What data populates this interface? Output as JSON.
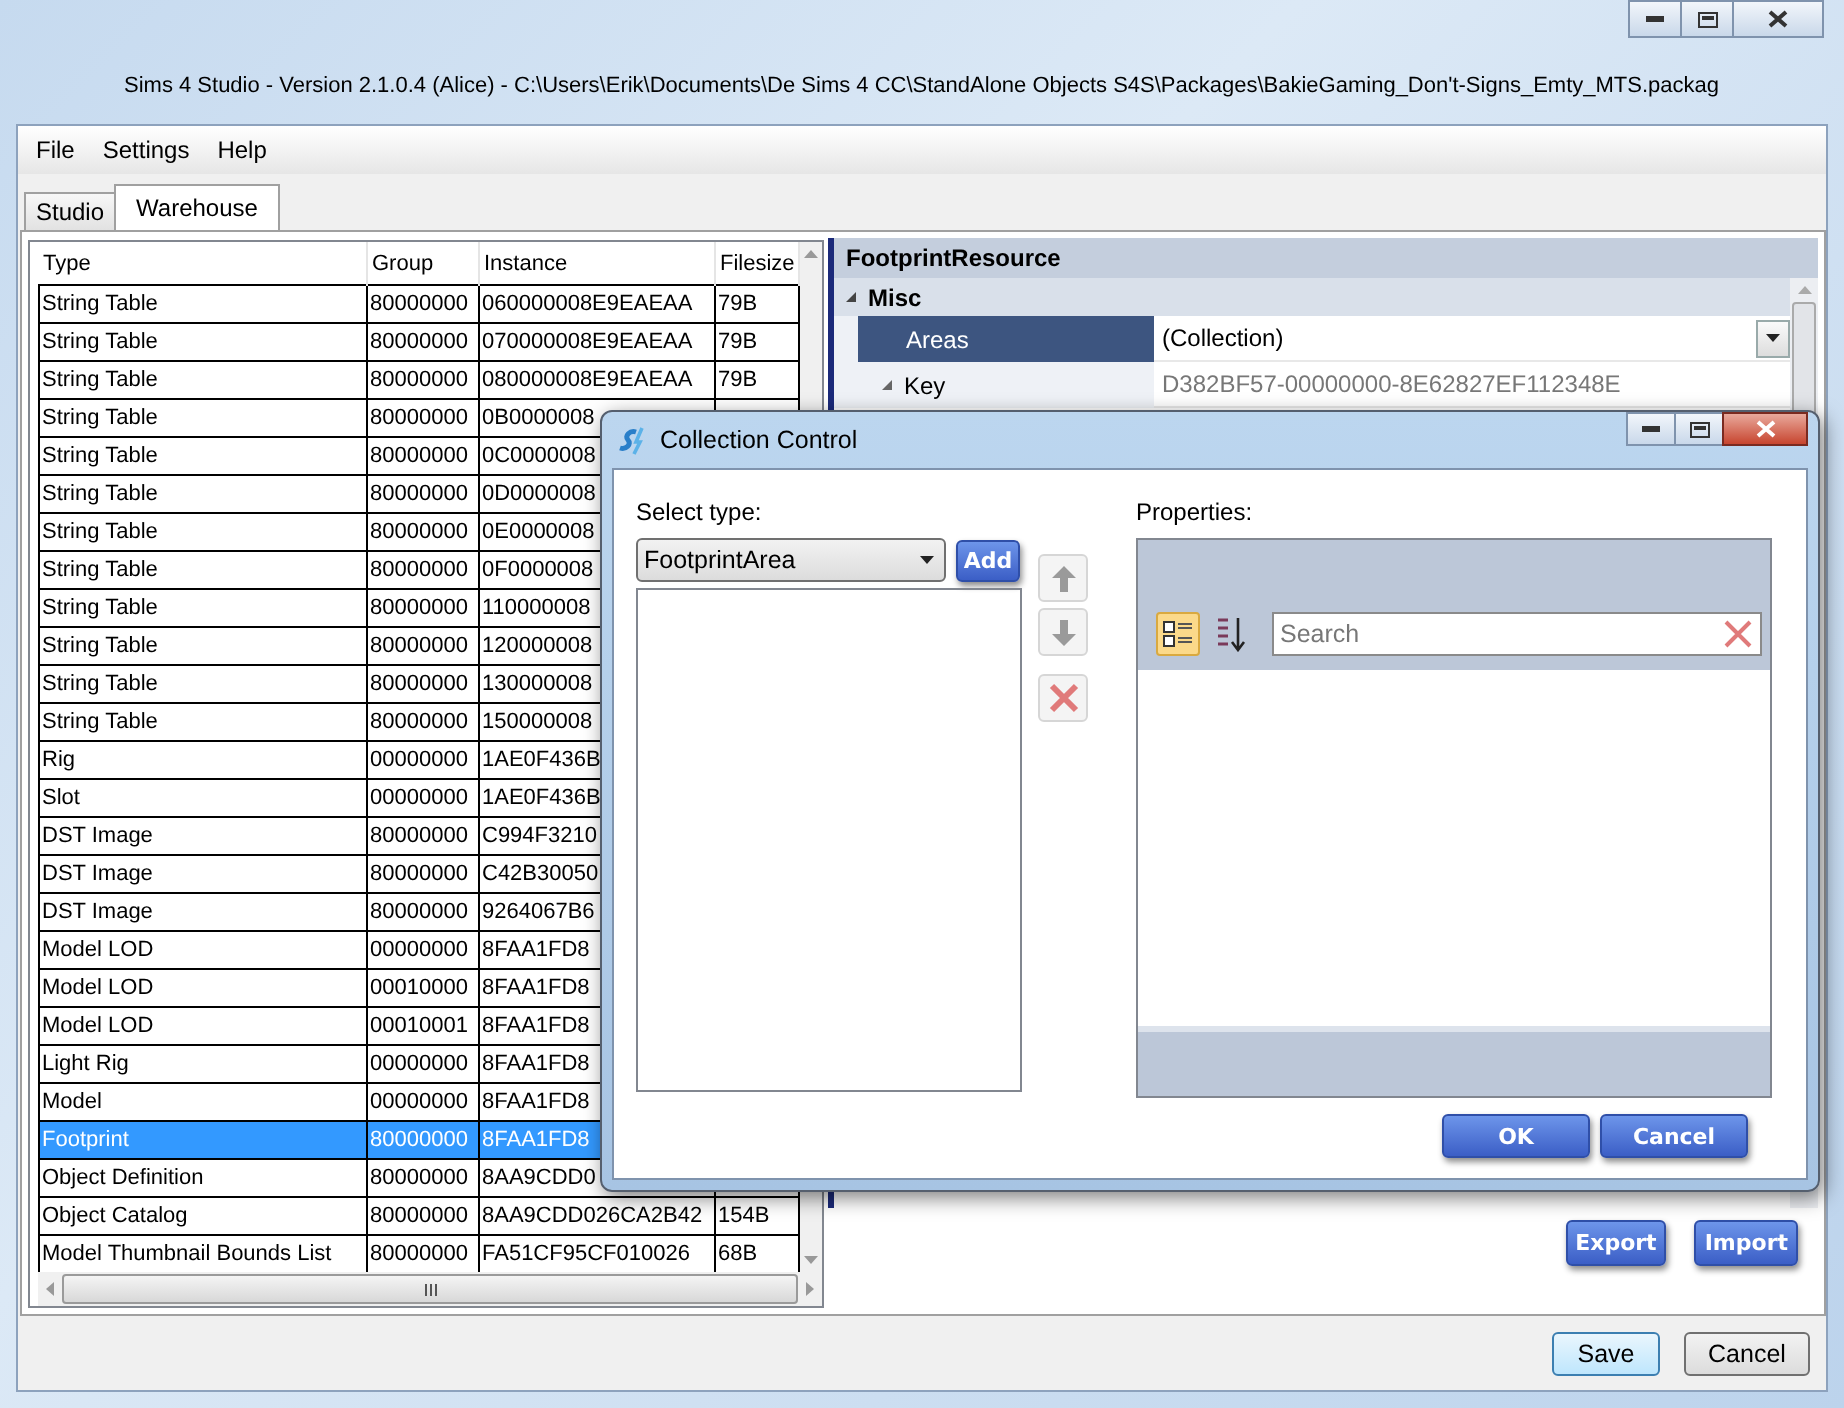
{
  "window": {
    "title": "Sims 4 Studio - Version 2.1.0.4  (Alice)   - C:\\Users\\Erik\\Documents\\De Sims 4 CC\\StandAlone Objects S4S\\Packages\\BakieGaming_Don't-Signs_Emty_MTS.packag"
  },
  "menu": [
    "File",
    "Settings",
    "Help"
  ],
  "tabs": [
    {
      "label": "Studio",
      "selected": false
    },
    {
      "label": "Warehouse",
      "selected": true
    }
  ],
  "table": {
    "columns": [
      "Type",
      "Group",
      "Instance",
      "Filesize"
    ],
    "rows": [
      {
        "cells": [
          "String Table",
          "80000000",
          "060000008E9EAEAA",
          "79B"
        ],
        "selected": false
      },
      {
        "cells": [
          "String Table",
          "80000000",
          "070000008E9EAEAA",
          "79B"
        ],
        "selected": false
      },
      {
        "cells": [
          "String Table",
          "80000000",
          "080000008E9EAEAA",
          "79B"
        ],
        "selected": false
      },
      {
        "cells": [
          "String Table",
          "80000000",
          "0B0000008"
        ],
        "selected": false
      },
      {
        "cells": [
          "String Table",
          "80000000",
          "0C0000008"
        ],
        "selected": false
      },
      {
        "cells": [
          "String Table",
          "80000000",
          "0D0000008"
        ],
        "selected": false
      },
      {
        "cells": [
          "String Table",
          "80000000",
          "0E0000008"
        ],
        "selected": false
      },
      {
        "cells": [
          "String Table",
          "80000000",
          "0F0000008"
        ],
        "selected": false
      },
      {
        "cells": [
          "String Table",
          "80000000",
          "110000008"
        ],
        "selected": false
      },
      {
        "cells": [
          "String Table",
          "80000000",
          "120000008"
        ],
        "selected": false
      },
      {
        "cells": [
          "String Table",
          "80000000",
          "130000008"
        ],
        "selected": false
      },
      {
        "cells": [
          "String Table",
          "80000000",
          "150000008"
        ],
        "selected": false
      },
      {
        "cells": [
          "Rig",
          "00000000",
          "1AE0F436B"
        ],
        "selected": false
      },
      {
        "cells": [
          "Slot",
          "00000000",
          "1AE0F436B"
        ],
        "selected": false
      },
      {
        "cells": [
          "DST Image",
          "80000000",
          "C994F3210"
        ],
        "selected": false
      },
      {
        "cells": [
          "DST Image",
          "80000000",
          "C42B30050"
        ],
        "selected": false
      },
      {
        "cells": [
          "DST Image",
          "80000000",
          "9264067B6"
        ],
        "selected": false
      },
      {
        "cells": [
          "Model LOD",
          "00000000",
          "8FAA1FD8"
        ],
        "selected": false
      },
      {
        "cells": [
          "Model LOD",
          "00010000",
          "8FAA1FD8"
        ],
        "selected": false
      },
      {
        "cells": [
          "Model LOD",
          "00010001",
          "8FAA1FD8"
        ],
        "selected": false
      },
      {
        "cells": [
          "Light Rig",
          "00000000",
          "8FAA1FD8"
        ],
        "selected": false
      },
      {
        "cells": [
          "Model",
          "00000000",
          "8FAA1FD8"
        ],
        "selected": false
      },
      {
        "cells": [
          "Footprint",
          "80000000",
          "8FAA1FD8"
        ],
        "selected": true
      },
      {
        "cells": [
          "Object Definition",
          "80000000",
          "8AA9CDD0"
        ],
        "selected": false
      },
      {
        "cells": [
          "Object Catalog",
          "80000000",
          "8AA9CDD026CA2B42",
          "154B"
        ],
        "selected": false
      },
      {
        "cells": [
          "Model Thumbnail Bounds List",
          "80000000",
          "FA51CF95CF010026",
          "68B"
        ],
        "selected": false
      }
    ]
  },
  "properties": {
    "header": "FootprintResource",
    "category": "Misc",
    "rows": [
      {
        "label": "Areas",
        "value": "(Collection)",
        "selected": true,
        "expanded": false,
        "kind": "dropdown"
      },
      {
        "label": "Key",
        "value": "D382BF57-00000000-8E62827EF112348E",
        "selected": false,
        "expanded": true,
        "kind": "readonly"
      }
    ]
  },
  "panel_buttons": [
    "Export",
    "Import"
  ],
  "bottom_buttons": [
    {
      "label": "Save",
      "default": true
    },
    {
      "label": "Cancel",
      "default": false
    }
  ],
  "dialog": {
    "title": "Collection Control",
    "select_label": "Select type:",
    "type_value": "FootprintArea",
    "add_label": "Add",
    "properties_label": "Properties:",
    "sort_modes": [
      {
        "kind": "categorized",
        "selected": true
      },
      {
        "kind": "alphabetical",
        "selected": false
      }
    ],
    "search": {
      "placeholder": "Search"
    },
    "buttons": [
      "OK",
      "Cancel"
    ]
  }
}
